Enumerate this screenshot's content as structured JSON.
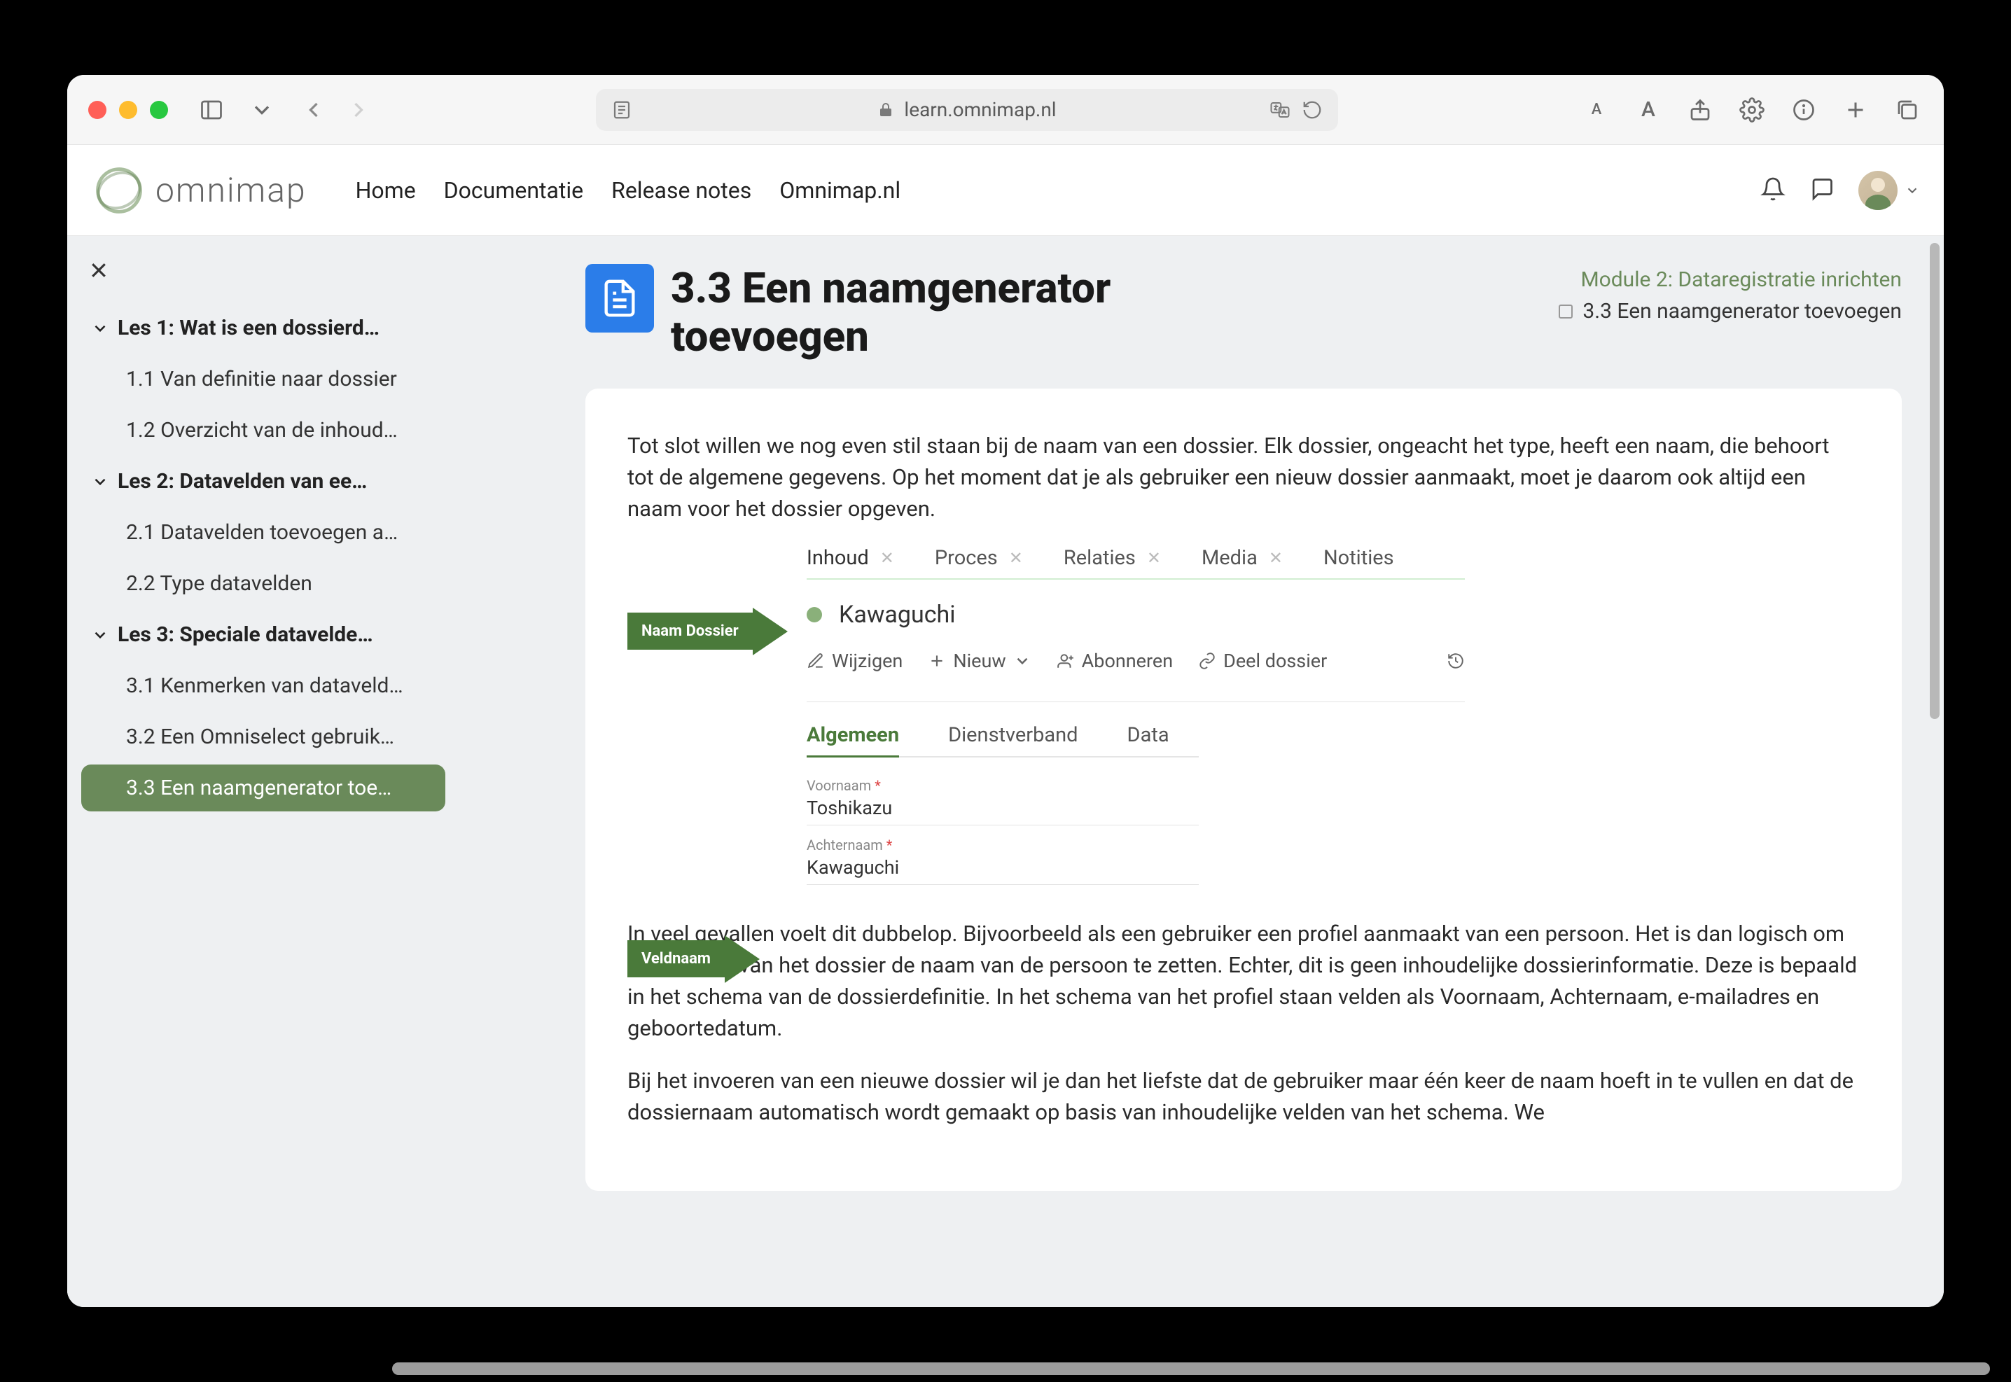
{
  "url": "learn.omnimap.nl",
  "header": {
    "logo_text": "omnimap",
    "nav": [
      "Home",
      "Documentatie",
      "Release notes",
      "Omnimap.nl"
    ]
  },
  "sidebar": {
    "lessons": [
      {
        "title": "Les 1: Wat is een dossierd…",
        "items": [
          "1.1 Van definitie naar dossier",
          "1.2 Overzicht van de inhoud…"
        ]
      },
      {
        "title": "Les 2: Datavelden van ee…",
        "items": [
          "2.1 Datavelden toevoegen a…",
          "2.2 Type datavelden"
        ]
      },
      {
        "title": "Les 3: Speciale datavelde…",
        "items": [
          "3.1 Kenmerken van dataveld…",
          "3.2 Een Omniselect gebruik…",
          "3.3 Een naamgenerator toe…"
        ],
        "active_index": 2
      }
    ]
  },
  "page": {
    "title": "3.3 Een naamgenerator toevoegen",
    "breadcrumb_top": "Module 2: Dataregistratie inrichten",
    "breadcrumb_bot": "3.3 Een naamgenerator toevoegen",
    "paragraphs": [
      "Tot slot willen we nog even stil staan bij de naam van een dossier. Elk dossier, ongeacht het type, heeft een naam, die behoort tot de algemene gegevens. Op het moment dat je als gebruiker een nieuw dossier aanmaakt, moet je daarom ook altijd een naam voor het dossier opgeven.",
      "In veel gevallen voelt dit dubbelop. Bijvoorbeeld als een gebruiker een profiel aanmaakt van een persoon. Het is dan logisch om in de naam van het dossier de naam van de persoon te zetten. Echter, dit is geen inhoudelijke dossierinformatie. Deze is bepaald in het schema van de dossierdefinitie. In het schema van het profiel staan velden als Voornaam, Achternaam, e-mailadres en geboortedatum.",
      "Bij het invoeren van een nieuwe dossier wil je dan het liefste dat de gebruiker maar één keer de naam hoeft in te vullen en dat de dossiernaam automatisch wordt gemaakt op basis van inhoudelijke velden van het schema. We"
    ]
  },
  "diagram": {
    "arrow1": "Naam Dossier",
    "arrow2": "Veldnaam",
    "top_tabs": [
      "Inhoud",
      "Proces",
      "Relaties",
      "Media",
      "Notities"
    ],
    "dossier_name": "Kawaguchi",
    "actions": {
      "wijzigen": "Wijzigen",
      "nieuw": "Nieuw",
      "abonneren": "Abonneren",
      "deel": "Deel dossier"
    },
    "subtabs": [
      "Algemeen",
      "Dienstverband",
      "Data"
    ],
    "fields": [
      {
        "label": "Voornaam",
        "value": "Toshikazu"
      },
      {
        "label": "Achternaam",
        "value": "Kawaguchi"
      }
    ]
  }
}
